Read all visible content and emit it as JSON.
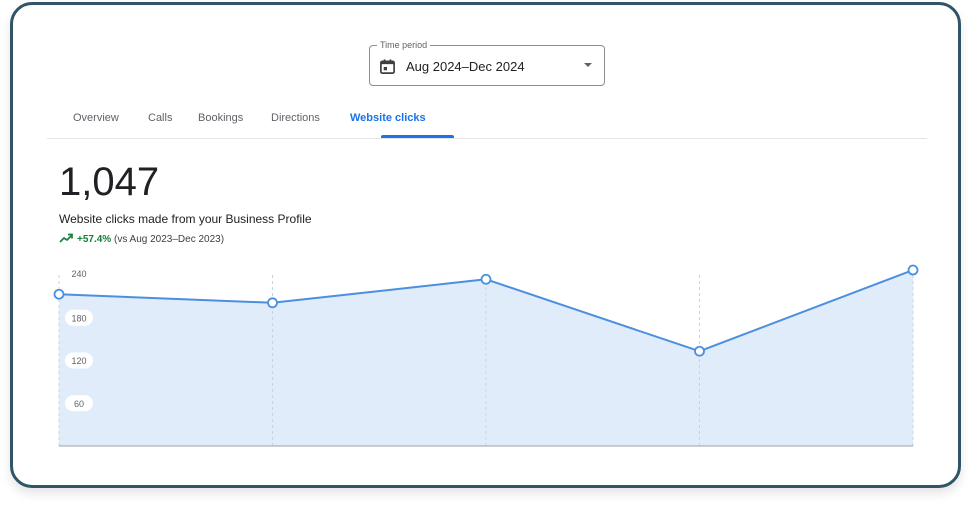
{
  "time_period": {
    "label": "Time period",
    "value": "Aug 2024–Dec 2024"
  },
  "tabs": [
    {
      "label": "Overview",
      "active": false
    },
    {
      "label": "Calls",
      "active": false
    },
    {
      "label": "Bookings",
      "active": false
    },
    {
      "label": "Directions",
      "active": false
    },
    {
      "label": "Website clicks",
      "active": true
    }
  ],
  "metric": {
    "value": "1,047",
    "description": "Website clicks made from your Business Profile",
    "change": "+57.4%",
    "comparison": "(vs Aug 2023–Dec 2023)"
  },
  "colors": {
    "accent": "#1a73e8",
    "positive": "#188038",
    "line": "#4a8fe0",
    "area": "#e1ecfb",
    "frame": "#2f5566"
  },
  "icons": {
    "time_picker": "calendar-icon",
    "dropdown": "dropdown-arrow-icon",
    "trend": "trend-up-icon"
  },
  "chart_data": {
    "type": "area",
    "title": "",
    "xlabel": "",
    "ylabel": "",
    "y_ticks": [
      "60",
      "120",
      "180",
      "240"
    ],
    "ylim": [
      0,
      240
    ],
    "grid": "vertical-dashed",
    "values": [
      213,
      201,
      234,
      133,
      247
    ],
    "marker": "hollow-circle"
  }
}
